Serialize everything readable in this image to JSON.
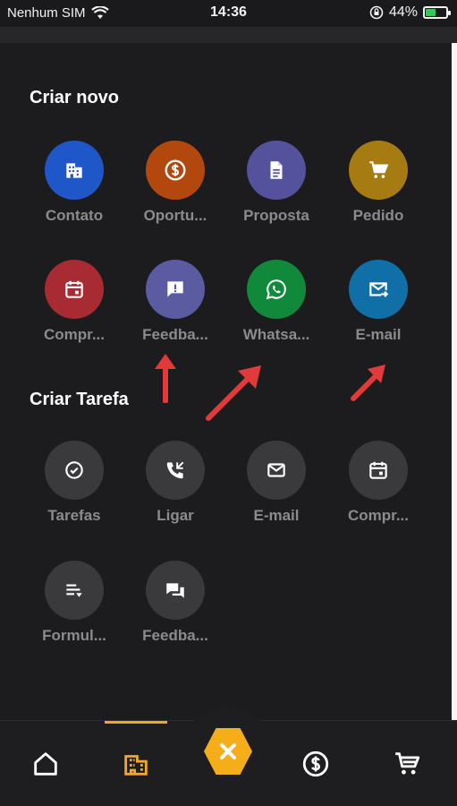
{
  "status_bar": {
    "carrier": "Nenhum SIM",
    "time": "14:36",
    "battery_percent": "44%",
    "battery_level": 0.44
  },
  "sections": {
    "create_new": {
      "title": "Criar novo",
      "items": [
        {
          "label": "Contato",
          "icon": "building-icon",
          "color": "#1f57c9"
        },
        {
          "label": "Oportu...",
          "icon": "dollar-icon",
          "color": "#b3480f"
        },
        {
          "label": "Proposta",
          "icon": "document-icon",
          "color": "#54519d"
        },
        {
          "label": "Pedido",
          "icon": "cart-icon",
          "color": "#a57b12"
        },
        {
          "label": "Compr...",
          "icon": "calendar-icon",
          "color": "#a82a33"
        },
        {
          "label": "Feedba...",
          "icon": "feedback-icon",
          "color": "#5a5ba0"
        },
        {
          "label": "Whatsa...",
          "icon": "whatsapp-icon",
          "color": "#108a3a"
        },
        {
          "label": "E-mail",
          "icon": "email-forward-icon",
          "color": "#0f6fa6"
        }
      ]
    },
    "create_task": {
      "title": "Criar Tarefa",
      "items": [
        {
          "label": "Tarefas",
          "icon": "check-icon",
          "color": "#3a3a3d"
        },
        {
          "label": "Ligar",
          "icon": "phone-icon",
          "color": "#3a3a3d"
        },
        {
          "label": "E-mail",
          "icon": "mail-icon",
          "color": "#3a3a3d"
        },
        {
          "label": "Compr...",
          "icon": "calendar-icon",
          "color": "#3a3a3d"
        },
        {
          "label": "Formul...",
          "icon": "form-icon",
          "color": "#3a3a3d"
        },
        {
          "label": "Feedba...",
          "icon": "chat-icon",
          "color": "#3a3a3d"
        }
      ]
    }
  },
  "bottom_nav": {
    "items": [
      "home-icon",
      "building-icon",
      "close-icon",
      "dollar-icon",
      "cart-icon"
    ],
    "active": "building-icon",
    "accent_color": "#f6ad1a"
  },
  "annotation_color": "#e23a3a"
}
